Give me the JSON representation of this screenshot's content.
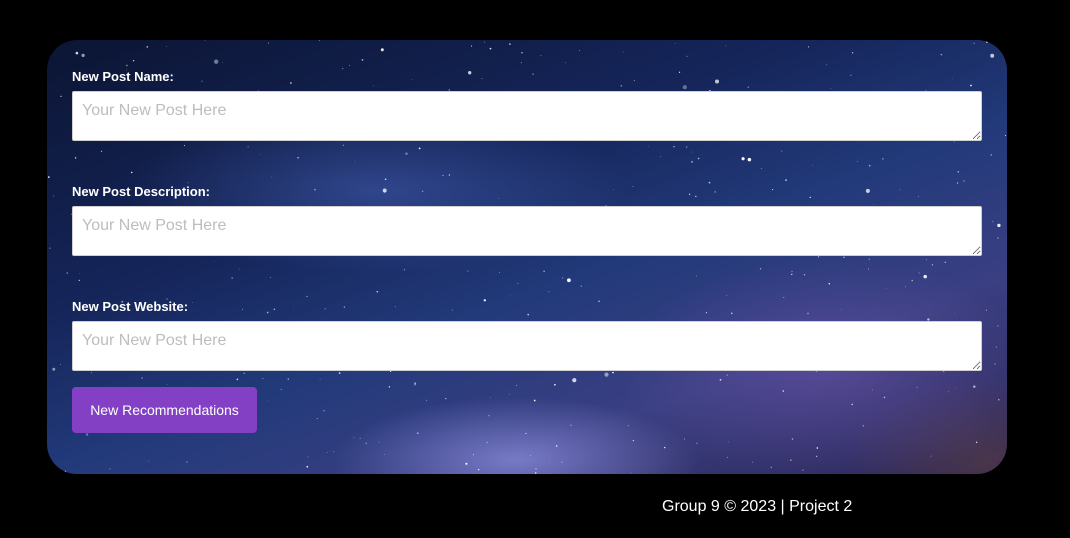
{
  "form": {
    "fields": [
      {
        "label": "New Post Name:",
        "placeholder": "Your New Post Here",
        "value": ""
      },
      {
        "label": "New Post Description:",
        "placeholder": "Your New Post Here",
        "value": ""
      },
      {
        "label": "New Post Website:",
        "placeholder": "Your New Post Here",
        "value": ""
      }
    ],
    "submit_label": "New Recommendations"
  },
  "footer": {
    "text": "Group 9 © 2023 | Project 2"
  },
  "colors": {
    "page_background": "#000000",
    "button": "#8340c4",
    "label_text": "#ffffff"
  }
}
